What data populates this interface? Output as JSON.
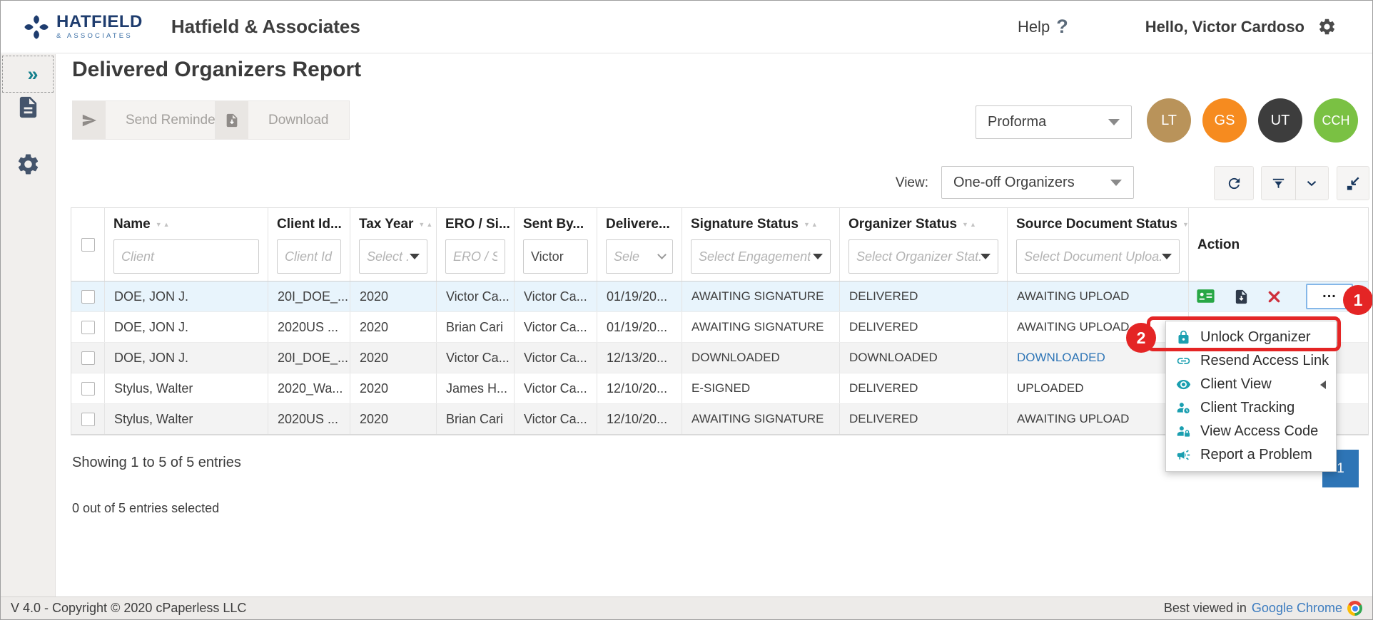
{
  "colors": {
    "teal": "#1b9fb0",
    "navy": "#17365d",
    "red": "#e42525",
    "blue": "#2e75b6",
    "green": "#28a745"
  },
  "header": {
    "brand": "HATFIELD",
    "brand_sub": "& ASSOCIATES",
    "app_title": "Hatfield & Associates",
    "help": "Help",
    "help_mark": "?",
    "greeting": "Hello, Victor Cardoso"
  },
  "page": {
    "title": "Delivered Organizers Report",
    "send_reminder": "Send Reminder",
    "download": "Download",
    "proforma": "Proforma",
    "view_label": "View:",
    "view_value": "One-off Organizers",
    "avatars": [
      {
        "initials": "LT",
        "color": "#b9935a"
      },
      {
        "initials": "GS",
        "color": "#f68b1f"
      },
      {
        "initials": "UT",
        "color": "#3d3d3d"
      },
      {
        "initials": "CCH",
        "color": "#7ac143"
      }
    ]
  },
  "table": {
    "headers": {
      "name": "Name",
      "client_id": "Client Id...",
      "tax_year": "Tax Year",
      "ero": "ERO / Si...",
      "sent_by": "Sent By...",
      "delivered": "Delivere...",
      "signature_status": "Signature Status",
      "organizer_status": "Organizer Status",
      "source_document_status": "Source Document Status",
      "action": "Action"
    },
    "filters": {
      "name_placeholder": "Client",
      "client_id_placeholder": "Client Id",
      "tax_year_placeholder": "Select ...",
      "ero_placeholder": "ERO / Si",
      "sent_by_value": "Victor",
      "delivered_placeholder": "Sele",
      "signature_placeholder": "Select Engagement",
      "organizer_placeholder": "Select Organizer Stat...",
      "source_placeholder": "Select Document Uploa..."
    },
    "rows": [
      {
        "name": "DOE, JON J.",
        "client_id": "20I_DOE_...",
        "tax_year": "2020",
        "ero": "Victor Ca...",
        "sent_by": "Victor Ca...",
        "delivered": "01/19/20...",
        "signature": "AWAITING SIGNATURE",
        "organizer": "DELIVERED",
        "source": "AWAITING UPLOAD"
      },
      {
        "name": "DOE, JON J.",
        "client_id": "2020US ...",
        "tax_year": "2020",
        "ero": "Brian Cari",
        "sent_by": "Victor Ca...",
        "delivered": "01/19/20...",
        "signature": "AWAITING SIGNATURE",
        "organizer": "DELIVERED",
        "source": "AWAITING UPLOAD"
      },
      {
        "name": "DOE, JON J.",
        "client_id": "20I_DOE_...",
        "tax_year": "2020",
        "ero": "Victor Ca...",
        "sent_by": "Victor Ca...",
        "delivered": "12/13/20...",
        "signature": "DOWNLOADED",
        "organizer": "DOWNLOADED",
        "source": "DOWNLOADED"
      },
      {
        "name": "Stylus, Walter",
        "client_id": "2020_Wa...",
        "tax_year": "2020",
        "ero": "James H...",
        "sent_by": "Victor Ca...",
        "delivered": "12/10/20...",
        "signature": "E-SIGNED",
        "organizer": "DELIVERED",
        "source": "UPLOADED"
      },
      {
        "name": "Stylus, Walter",
        "client_id": "2020US ...",
        "tax_year": "2020",
        "ero": "Brian Cari",
        "sent_by": "Victor Ca...",
        "delivered": "12/10/20...",
        "signature": "AWAITING SIGNATURE",
        "organizer": "DELIVERED",
        "source": "AWAITING UPLOAD"
      }
    ],
    "action_ellipsis": "..."
  },
  "summary": {
    "showing": "Showing 1 to 5 of 5 entries",
    "selected": "0 out of 5 entries selected"
  },
  "pagination": {
    "page_1": "1"
  },
  "menu": {
    "items": [
      {
        "label": "Unlock Organizer"
      },
      {
        "label": "Resend Access Link"
      },
      {
        "label": "Client View"
      },
      {
        "label": "Client Tracking"
      },
      {
        "label": "View Access Code"
      },
      {
        "label": "Report a Problem"
      }
    ]
  },
  "annotations": {
    "step1": "1",
    "step2": "2"
  },
  "footer": {
    "version": "V 4.0 - Copyright © 2020 cPaperless LLC",
    "viewed": "Best viewed in",
    "browser": "Google Chrome"
  }
}
